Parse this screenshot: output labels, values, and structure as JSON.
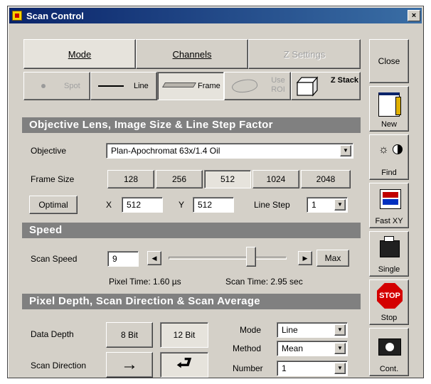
{
  "window": {
    "title": "Scan Control",
    "close_glyph": "×"
  },
  "tabs": [
    {
      "label": "Mode",
      "state": "active"
    },
    {
      "label": "Channels",
      "state": "normal"
    },
    {
      "label": "Z Settings",
      "state": "disabled"
    }
  ],
  "scan_modes": [
    {
      "label": "Spot",
      "icon": "spot-icon",
      "state": "disabled"
    },
    {
      "label": "Line",
      "icon": "line-icon",
      "state": "normal"
    },
    {
      "label": "Frame",
      "icon": "frame-icon",
      "state": "selected"
    },
    {
      "label": "Use ROI",
      "icon": "roi-icon",
      "state": "disabled"
    },
    {
      "label": "Z Stack",
      "icon": "z-stack-icon",
      "state": "normal"
    }
  ],
  "sections": {
    "objective": "Objective Lens, Image Size & Line Step Factor",
    "speed": "Speed",
    "pixel": "Pixel Depth, Scan Direction & Scan Average"
  },
  "objective": {
    "label": "Objective",
    "value": "Plan-Apochromat 63x/1.4 Oil"
  },
  "frame_size": {
    "label": "Frame Size",
    "options": [
      "128",
      "256",
      "512",
      "1024",
      "2048"
    ],
    "selected": "512",
    "optimal_label": "Optimal",
    "x_label": "X",
    "x_value": "512",
    "y_label": "Y",
    "y_value": "512",
    "line_step_label": "Line Step",
    "line_step_value": "1"
  },
  "speed": {
    "label": "Scan Speed",
    "value": "9",
    "max_label": "Max",
    "pixel_time": "Pixel Time: 1.60 µs",
    "scan_time": "Scan Time: 2.95 sec",
    "slider_level_fraction": 0.72
  },
  "pixel": {
    "data_depth_label": "Data Depth",
    "depth_options": [
      "8 Bit",
      "12 Bit"
    ],
    "depth_selected": "12 Bit",
    "scan_direction_label": "Scan Direction",
    "mode_label": "Mode",
    "mode_value": "Line",
    "method_label": "Method",
    "method_value": "Mean",
    "number_label": "Number",
    "number_value": "1"
  },
  "sidebar": {
    "close": "Close",
    "new": "New",
    "find": "Find",
    "fast_xy": "Fast XY",
    "single": "Single",
    "stop": "Stop",
    "stop_badge": "STOP",
    "cont": "Cont."
  },
  "colors": {
    "title_gradient_start": "#0a246a",
    "title_gradient_end": "#3a6ea5",
    "section_header_bg": "#808080",
    "face": "#d4d0c8",
    "stop_red": "#d40000"
  }
}
